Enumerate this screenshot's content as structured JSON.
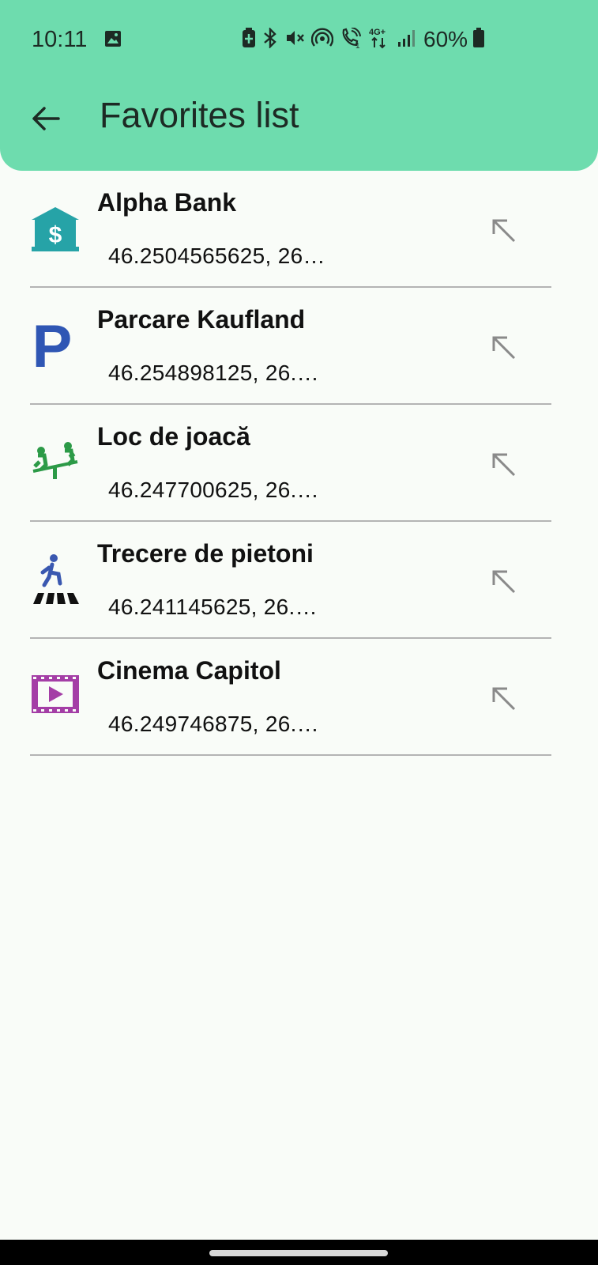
{
  "status_bar": {
    "time": "10:11",
    "battery": "60%",
    "network": "4G+",
    "icons": [
      "gallery-icon",
      "battery-saver-icon",
      "bluetooth-icon",
      "vibrate-off-icon",
      "hotspot-icon",
      "wifi-call-icon",
      "signal-icon",
      "battery-icon"
    ]
  },
  "header": {
    "title": "Favorites list"
  },
  "favorites": [
    {
      "name": "Alpha Bank",
      "coords": "46.2504565625, 26…",
      "icon": "bank-icon",
      "color": "#26a3a7"
    },
    {
      "name": "Parcare Kaufland",
      "coords": "46.254898125, 26.…",
      "icon": "parking-icon",
      "color": "#2f56b4"
    },
    {
      "name": "Loc de joacă",
      "coords": "46.247700625, 26.…",
      "icon": "playground-icon",
      "color": "#2c9a47"
    },
    {
      "name": "Trecere de pietoni",
      "coords": "46.241145625, 26.…",
      "icon": "crosswalk-icon",
      "color": "#3a58b0"
    },
    {
      "name": "Cinema Capitol",
      "coords": "46.249746875, 26.…",
      "icon": "cinema-icon",
      "color": "#a43ea6"
    }
  ],
  "colors": {
    "appbar": "#6edcae",
    "background": "#f9fcf8",
    "divider": "#b4b4b4",
    "arrow": "#8a8a8a"
  }
}
